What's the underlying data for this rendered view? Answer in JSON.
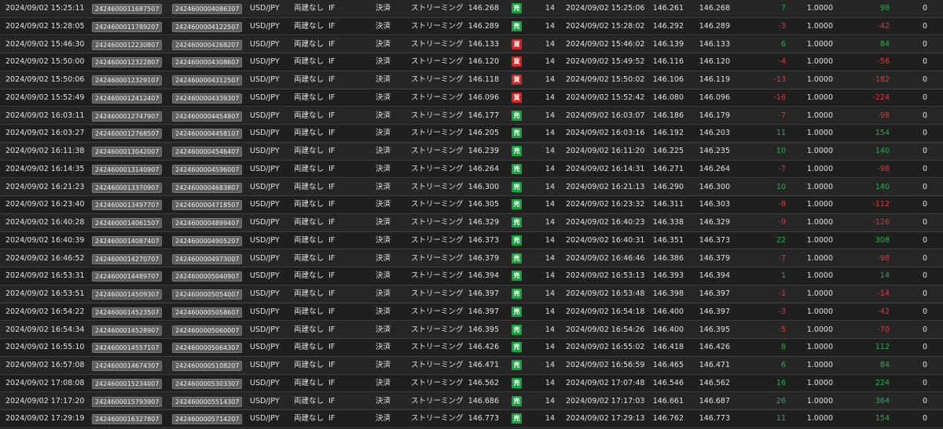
{
  "colors": {
    "background": "#1f1f1f",
    "row_alt": "#262626",
    "sell_badge": "#11a83a",
    "buy_badge": "#d92323",
    "profit": "#28b04a",
    "loss": "#e03a3a"
  },
  "icons": {
    "sell": "sell-side-icon",
    "buy": "buy-side-icon"
  },
  "rows": [
    {
      "time": "2024/09/02 15:25:11",
      "order_no": "2424600011687507",
      "position_no": "2424600004086307",
      "pair": "USD/JPY",
      "hedge": "両建なし",
      "condition": "IF",
      "kind": "決済",
      "execution": "ストリーミング",
      "price": "146.268",
      "side": "売",
      "side_type": "sell",
      "qty": "14",
      "open_time": "2024/09/02 15:25:06",
      "open_price": "146.261",
      "close_price": "146.268",
      "pips": "7",
      "pips_sign": "pos",
      "rate": "1.0000",
      "pl": "98",
      "pl_sign": "pos",
      "zero": "0"
    },
    {
      "time": "2024/09/02 15:28:05",
      "order_no": "2424600011789207",
      "position_no": "2424600004122507",
      "pair": "USD/JPY",
      "hedge": "両建なし",
      "condition": "IF",
      "kind": "決済",
      "execution": "ストリーミング",
      "price": "146.289",
      "side": "売",
      "side_type": "sell",
      "qty": "14",
      "open_time": "2024/09/02 15:28:02",
      "open_price": "146.292",
      "close_price": "146.289",
      "pips": "-3",
      "pips_sign": "neg",
      "rate": "1.0000",
      "pl": "-42",
      "pl_sign": "neg",
      "zero": "0"
    },
    {
      "time": "2024/09/02 15:46:30",
      "order_no": "2424600012230807",
      "position_no": "2424600004268207",
      "pair": "USD/JPY",
      "hedge": "両建なし",
      "condition": "IF",
      "kind": "決済",
      "execution": "ストリーミング",
      "price": "146.133",
      "side": "買",
      "side_type": "buy",
      "qty": "14",
      "open_time": "2024/09/02 15:46:02",
      "open_price": "146.139",
      "close_price": "146.133",
      "pips": "6",
      "pips_sign": "pos",
      "rate": "1.0000",
      "pl": "84",
      "pl_sign": "pos",
      "zero": "0"
    },
    {
      "time": "2024/09/02 15:50:00",
      "order_no": "2424600012322807",
      "position_no": "2424600004308607",
      "pair": "USD/JPY",
      "hedge": "両建なし",
      "condition": "IF",
      "kind": "決済",
      "execution": "ストリーミング",
      "price": "146.120",
      "side": "買",
      "side_type": "buy",
      "qty": "14",
      "open_time": "2024/09/02 15:49:52",
      "open_price": "146.116",
      "close_price": "146.120",
      "pips": "-4",
      "pips_sign": "neg",
      "rate": "1.0000",
      "pl": "-56",
      "pl_sign": "neg",
      "zero": "0"
    },
    {
      "time": "2024/09/02 15:50:06",
      "order_no": "2424600012329107",
      "position_no": "2424600004312507",
      "pair": "USD/JPY",
      "hedge": "両建なし",
      "condition": "IF",
      "kind": "決済",
      "execution": "ストリーミング",
      "price": "146.118",
      "side": "買",
      "side_type": "buy",
      "qty": "14",
      "open_time": "2024/09/02 15:50:02",
      "open_price": "146.106",
      "close_price": "146.119",
      "pips": "-13",
      "pips_sign": "neg",
      "rate": "1.0000",
      "pl": "-182",
      "pl_sign": "neg",
      "zero": "0"
    },
    {
      "time": "2024/09/02 15:52:49",
      "order_no": "2424600012412407",
      "position_no": "2424600004339307",
      "pair": "USD/JPY",
      "hedge": "両建なし",
      "condition": "IF",
      "kind": "決済",
      "execution": "ストリーミング",
      "price": "146.096",
      "side": "買",
      "side_type": "buy",
      "qty": "14",
      "open_time": "2024/09/02 15:52:42",
      "open_price": "146.080",
      "close_price": "146.096",
      "pips": "-16",
      "pips_sign": "neg",
      "rate": "1.0000",
      "pl": "-224",
      "pl_sign": "neg",
      "zero": "0"
    },
    {
      "time": "2024/09/02 16:03:11",
      "order_no": "2424600012747907",
      "position_no": "2424600004454807",
      "pair": "USD/JPY",
      "hedge": "両建なし",
      "condition": "IF",
      "kind": "決済",
      "execution": "ストリーミング",
      "price": "146.177",
      "side": "売",
      "side_type": "sell",
      "qty": "14",
      "open_time": "2024/09/02 16:03:07",
      "open_price": "146.186",
      "close_price": "146.179",
      "pips": "-7",
      "pips_sign": "neg",
      "rate": "1.0000",
      "pl": "-98",
      "pl_sign": "neg",
      "zero": "0"
    },
    {
      "time": "2024/09/02 16:03:27",
      "order_no": "2424600012768507",
      "position_no": "2424600004458107",
      "pair": "USD/JPY",
      "hedge": "両建なし",
      "condition": "IF",
      "kind": "決済",
      "execution": "ストリーミング",
      "price": "146.205",
      "side": "売",
      "side_type": "sell",
      "qty": "14",
      "open_time": "2024/09/02 16:03:16",
      "open_price": "146.192",
      "close_price": "146.203",
      "pips": "11",
      "pips_sign": "pos",
      "rate": "1.0000",
      "pl": "154",
      "pl_sign": "pos",
      "zero": "0"
    },
    {
      "time": "2024/09/02 16:11:38",
      "order_no": "2424600013042007",
      "position_no": "2424600004546407",
      "pair": "USD/JPY",
      "hedge": "両建なし",
      "condition": "IF",
      "kind": "決済",
      "execution": "ストリーミング",
      "price": "146.239",
      "side": "売",
      "side_type": "sell",
      "qty": "14",
      "open_time": "2024/09/02 16:11:20",
      "open_price": "146.225",
      "close_price": "146.235",
      "pips": "10",
      "pips_sign": "pos",
      "rate": "1.0000",
      "pl": "140",
      "pl_sign": "pos",
      "zero": "0"
    },
    {
      "time": "2024/09/02 16:14:35",
      "order_no": "2424600013140907",
      "position_no": "2424600004596007",
      "pair": "USD/JPY",
      "hedge": "両建なし",
      "condition": "IF",
      "kind": "決済",
      "execution": "ストリーミング",
      "price": "146.264",
      "side": "売",
      "side_type": "sell",
      "qty": "14",
      "open_time": "2024/09/02 16:14:31",
      "open_price": "146.271",
      "close_price": "146.264",
      "pips": "-7",
      "pips_sign": "neg",
      "rate": "1.0000",
      "pl": "-98",
      "pl_sign": "neg",
      "zero": "0"
    },
    {
      "time": "2024/09/02 16:21:23",
      "order_no": "2424600013370907",
      "position_no": "2424600004683807",
      "pair": "USD/JPY",
      "hedge": "両建なし",
      "condition": "IF",
      "kind": "決済",
      "execution": "ストリーミング",
      "price": "146.300",
      "side": "売",
      "side_type": "sell",
      "qty": "14",
      "open_time": "2024/09/02 16:21:13",
      "open_price": "146.290",
      "close_price": "146.300",
      "pips": "10",
      "pips_sign": "pos",
      "rate": "1.0000",
      "pl": "140",
      "pl_sign": "pos",
      "zero": "0"
    },
    {
      "time": "2024/09/02 16:23:40",
      "order_no": "2424600013497707",
      "position_no": "2424600004718507",
      "pair": "USD/JPY",
      "hedge": "両建なし",
      "condition": "IF",
      "kind": "決済",
      "execution": "ストリーミング",
      "price": "146.305",
      "side": "売",
      "side_type": "sell",
      "qty": "14",
      "open_time": "2024/09/02 16:23:32",
      "open_price": "146.311",
      "close_price": "146.303",
      "pips": "-8",
      "pips_sign": "neg",
      "rate": "1.0000",
      "pl": "-112",
      "pl_sign": "neg",
      "zero": "0"
    },
    {
      "time": "2024/09/02 16:40:28",
      "order_no": "2424600014061507",
      "position_no": "2424600004899407",
      "pair": "USD/JPY",
      "hedge": "両建なし",
      "condition": "IF",
      "kind": "決済",
      "execution": "ストリーミング",
      "price": "146.329",
      "side": "売",
      "side_type": "sell",
      "qty": "14",
      "open_time": "2024/09/02 16:40:23",
      "open_price": "146.338",
      "close_price": "146.329",
      "pips": "-9",
      "pips_sign": "neg",
      "rate": "1.0000",
      "pl": "-126",
      "pl_sign": "neg",
      "zero": "0"
    },
    {
      "time": "2024/09/02 16:40:39",
      "order_no": "2424600014087407",
      "position_no": "2424600004905207",
      "pair": "USD/JPY",
      "hedge": "両建なし",
      "condition": "IF",
      "kind": "決済",
      "execution": "ストリーミング",
      "price": "146.373",
      "side": "売",
      "side_type": "sell",
      "qty": "14",
      "open_time": "2024/09/02 16:40:31",
      "open_price": "146.351",
      "close_price": "146.373",
      "pips": "22",
      "pips_sign": "pos",
      "rate": "1.0000",
      "pl": "308",
      "pl_sign": "pos",
      "zero": "0"
    },
    {
      "time": "2024/09/02 16:46:52",
      "order_no": "2424600014270707",
      "position_no": "2424600004973007",
      "pair": "USD/JPY",
      "hedge": "両建なし",
      "condition": "IF",
      "kind": "決済",
      "execution": "ストリーミング",
      "price": "146.379",
      "side": "売",
      "side_type": "sell",
      "qty": "14",
      "open_time": "2024/09/02 16:46:46",
      "open_price": "146.386",
      "close_price": "146.379",
      "pips": "-7",
      "pips_sign": "neg",
      "rate": "1.0000",
      "pl": "-98",
      "pl_sign": "neg",
      "zero": "0"
    },
    {
      "time": "2024/09/02 16:53:31",
      "order_no": "2424600014489707",
      "position_no": "2424600005040907",
      "pair": "USD/JPY",
      "hedge": "両建なし",
      "condition": "IF",
      "kind": "決済",
      "execution": "ストリーミング",
      "price": "146.394",
      "side": "売",
      "side_type": "sell",
      "qty": "14",
      "open_time": "2024/09/02 16:53:13",
      "open_price": "146.393",
      "close_price": "146.394",
      "pips": "1",
      "pips_sign": "pos",
      "rate": "1.0000",
      "pl": "14",
      "pl_sign": "pos",
      "zero": "0"
    },
    {
      "time": "2024/09/02 16:53:51",
      "order_no": "2424600014509307",
      "position_no": "2424600005054007",
      "pair": "USD/JPY",
      "hedge": "両建なし",
      "condition": "IF",
      "kind": "決済",
      "execution": "ストリーミング",
      "price": "146.397",
      "side": "売",
      "side_type": "sell",
      "qty": "14",
      "open_time": "2024/09/02 16:53:48",
      "open_price": "146.398",
      "close_price": "146.397",
      "pips": "-1",
      "pips_sign": "neg",
      "rate": "1.0000",
      "pl": "-14",
      "pl_sign": "neg",
      "zero": "0"
    },
    {
      "time": "2024/09/02 16:54:22",
      "order_no": "2424600014523507",
      "position_no": "2424600005058607",
      "pair": "USD/JPY",
      "hedge": "両建なし",
      "condition": "IF",
      "kind": "決済",
      "execution": "ストリーミング",
      "price": "146.397",
      "side": "売",
      "side_type": "sell",
      "qty": "14",
      "open_time": "2024/09/02 16:54:18",
      "open_price": "146.400",
      "close_price": "146.397",
      "pips": "-3",
      "pips_sign": "neg",
      "rate": "1.0000",
      "pl": "-42",
      "pl_sign": "neg",
      "zero": "0"
    },
    {
      "time": "2024/09/02 16:54:34",
      "order_no": "2424600014528907",
      "position_no": "2424600005060007",
      "pair": "USD/JPY",
      "hedge": "両建なし",
      "condition": "IF",
      "kind": "決済",
      "execution": "ストリーミング",
      "price": "146.395",
      "side": "売",
      "side_type": "sell",
      "qty": "14",
      "open_time": "2024/09/02 16:54:26",
      "open_price": "146.400",
      "close_price": "146.395",
      "pips": "-5",
      "pips_sign": "neg",
      "rate": "1.0000",
      "pl": "-70",
      "pl_sign": "neg",
      "zero": "0"
    },
    {
      "time": "2024/09/02 16:55:10",
      "order_no": "2424600014557107",
      "position_no": "2424600005064307",
      "pair": "USD/JPY",
      "hedge": "両建なし",
      "condition": "IF",
      "kind": "決済",
      "execution": "ストリーミング",
      "price": "146.426",
      "side": "売",
      "side_type": "sell",
      "qty": "14",
      "open_time": "2024/09/02 16:55:02",
      "open_price": "146.418",
      "close_price": "146.426",
      "pips": "8",
      "pips_sign": "pos",
      "rate": "1.0000",
      "pl": "112",
      "pl_sign": "pos",
      "zero": "0"
    },
    {
      "time": "2024/09/02 16:57:08",
      "order_no": "2424600014674307",
      "position_no": "2424600005108207",
      "pair": "USD/JPY",
      "hedge": "両建なし",
      "condition": "IF",
      "kind": "決済",
      "execution": "ストリーミング",
      "price": "146.471",
      "side": "売",
      "side_type": "sell",
      "qty": "14",
      "open_time": "2024/09/02 16:56:59",
      "open_price": "146.465",
      "close_price": "146.471",
      "pips": "6",
      "pips_sign": "pos",
      "rate": "1.0000",
      "pl": "84",
      "pl_sign": "pos",
      "zero": "0"
    },
    {
      "time": "2024/09/02 17:08:08",
      "order_no": "2424600015234007",
      "position_no": "2424600005303307",
      "pair": "USD/JPY",
      "hedge": "両建なし",
      "condition": "IF",
      "kind": "決済",
      "execution": "ストリーミング",
      "price": "146.562",
      "side": "売",
      "side_type": "sell",
      "qty": "14",
      "open_time": "2024/09/02 17:07:48",
      "open_price": "146.546",
      "close_price": "146.562",
      "pips": "16",
      "pips_sign": "pos",
      "rate": "1.0000",
      "pl": "224",
      "pl_sign": "pos",
      "zero": "0"
    },
    {
      "time": "2024/09/02 17:17:20",
      "order_no": "2424600015793907",
      "position_no": "2424600005514307",
      "pair": "USD/JPY",
      "hedge": "両建なし",
      "condition": "IF",
      "kind": "決済",
      "execution": "ストリーミング",
      "price": "146.686",
      "side": "売",
      "side_type": "sell",
      "qty": "14",
      "open_time": "2024/09/02 17:17:03",
      "open_price": "146.661",
      "close_price": "146.687",
      "pips": "26",
      "pips_sign": "pos",
      "rate": "1.0000",
      "pl": "364",
      "pl_sign": "pos",
      "zero": "0"
    },
    {
      "time": "2024/09/02 17:29:19",
      "order_no": "2424600016327807",
      "position_no": "2424600005714207",
      "pair": "USD/JPY",
      "hedge": "両建なし",
      "condition": "IF",
      "kind": "決済",
      "execution": "ストリーミング",
      "price": "146.773",
      "side": "売",
      "side_type": "sell",
      "qty": "14",
      "open_time": "2024/09/02 17:29:13",
      "open_price": "146.762",
      "close_price": "146.773",
      "pips": "11",
      "pips_sign": "pos",
      "rate": "1.0000",
      "pl": "154",
      "pl_sign": "pos",
      "zero": "0"
    }
  ]
}
